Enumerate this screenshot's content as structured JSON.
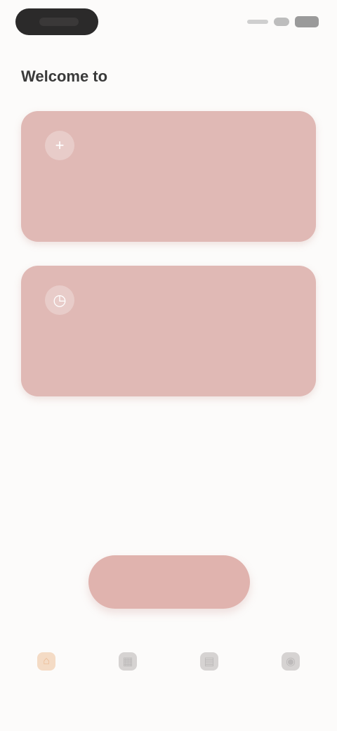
{
  "greeting": {
    "text": "Welcome to ",
    "accent": "",
    "accent_color": "#e9b7b3"
  },
  "cards": [
    {
      "icon": "plus-icon",
      "icon_glyph": "+",
      "title": "",
      "description": ""
    },
    {
      "icon": "clock-icon",
      "icon_glyph": "◷",
      "title": "",
      "description": ""
    }
  ],
  "section": {
    "title": ""
  },
  "empty_state": {
    "title": "",
    "description": "",
    "button_label": ""
  },
  "bottom_nav": {
    "items": [
      {
        "icon": "home-icon",
        "glyph": "⌂",
        "label": ""
      },
      {
        "icon": "calendar-icon",
        "glyph": "▦",
        "label": ""
      },
      {
        "icon": "chart-icon",
        "glyph": "▤",
        "label": ""
      },
      {
        "icon": "profile-icon",
        "glyph": "◉",
        "label": ""
      }
    ],
    "active_index": 0
  },
  "colors": {
    "card": "#e0b9b5",
    "button": "#e0b3ae",
    "active_nav": "#f3d4b8"
  }
}
